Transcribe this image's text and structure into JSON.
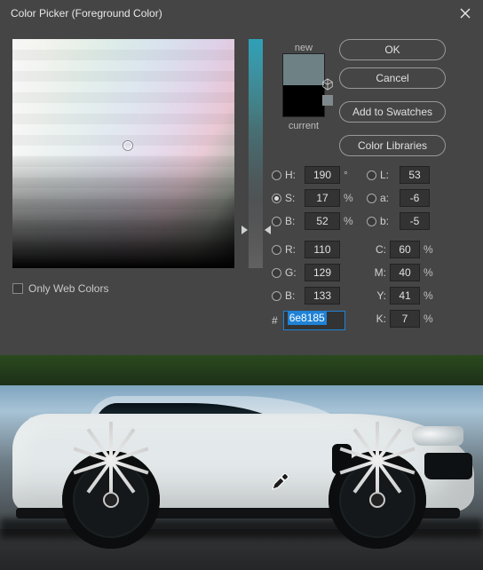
{
  "title": "Color Picker (Foreground Color)",
  "buttons": {
    "ok": "OK",
    "cancel": "Cancel",
    "addSwatches": "Add to Swatches",
    "libraries": "Color Libraries"
  },
  "swatch": {
    "newLabel": "new",
    "currentLabel": "current",
    "newColor": "#6e8185",
    "currentColor": "#000000"
  },
  "hsb": {
    "h": {
      "label": "H:",
      "value": "190",
      "unit": "°",
      "selected": false
    },
    "s": {
      "label": "S:",
      "value": "17",
      "unit": "%",
      "selected": true
    },
    "b": {
      "label": "B:",
      "value": "52",
      "unit": "%",
      "selected": false
    }
  },
  "lab": {
    "l": {
      "label": "L:",
      "value": "53",
      "selected": false
    },
    "a": {
      "label": "a:",
      "value": "-6",
      "selected": false
    },
    "b": {
      "label": "b:",
      "value": "-5",
      "selected": false
    }
  },
  "rgb": {
    "r": {
      "label": "R:",
      "value": "110",
      "selected": false
    },
    "g": {
      "label": "G:",
      "value": "129",
      "selected": false
    },
    "b": {
      "label": "B:",
      "value": "133",
      "selected": false
    }
  },
  "cmyk": {
    "c": {
      "label": "C:",
      "value": "60",
      "unit": "%"
    },
    "m": {
      "label": "M:",
      "value": "40",
      "unit": "%"
    },
    "y": {
      "label": "Y:",
      "value": "41",
      "unit": "%"
    },
    "k": {
      "label": "K:",
      "value": "7",
      "unit": "%"
    }
  },
  "hex": {
    "label": "#",
    "value": "6e8185"
  },
  "webColors": {
    "label": "Only Web Colors",
    "checked": false
  }
}
